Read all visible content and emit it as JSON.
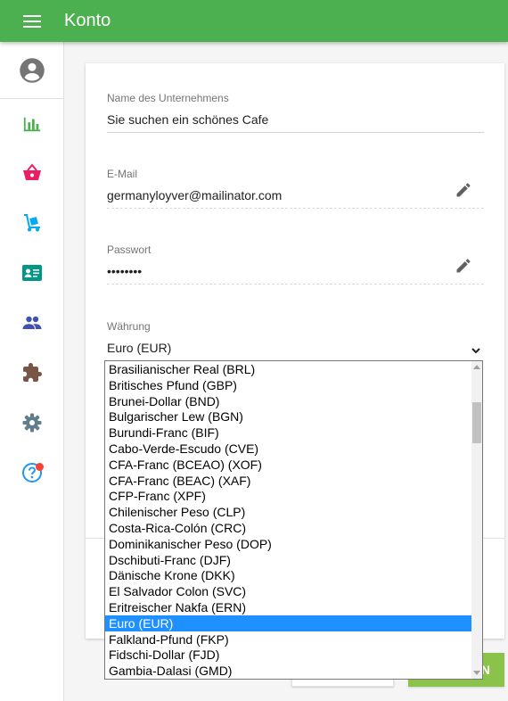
{
  "app": {
    "title": "Konto"
  },
  "sidebar": {
    "items": [
      {
        "name": "avatar",
        "icon": "account-circle-icon",
        "color": "#757575"
      },
      {
        "name": "statistics",
        "icon": "bar-chart-icon",
        "color": "#4caf50"
      },
      {
        "name": "shop",
        "icon": "shopping-basket-icon",
        "color": "#e91e63"
      },
      {
        "name": "delivery",
        "icon": "hand-truck-icon",
        "color": "#03a9f4"
      },
      {
        "name": "contacts",
        "icon": "contact-card-icon",
        "color": "#009688"
      },
      {
        "name": "people",
        "icon": "people-icon",
        "color": "#3f51b5"
      },
      {
        "name": "extensions",
        "icon": "puzzle-icon",
        "color": "#795548"
      },
      {
        "name": "settings",
        "icon": "gear-icon",
        "color": "#607d8b"
      },
      {
        "name": "help",
        "icon": "help-circle-icon",
        "color": "#2196f3",
        "badge_color": "#f44336"
      }
    ]
  },
  "form": {
    "company": {
      "label": "Name des Unternehmens",
      "value": "Sie suchen ein schönes Cafe"
    },
    "email": {
      "label": "E-Mail",
      "value": "germanyloyver@mailinator.com"
    },
    "password": {
      "label": "Passwort",
      "value": "••••••••"
    },
    "currency": {
      "label": "Währung",
      "value": "Euro (EUR)"
    }
  },
  "dropdown": {
    "options": [
      "Brasilianischer Real (BRL)",
      "Britisches Pfund (GBP)",
      "Brunei-Dollar (BND)",
      "Bulgarischer Lew (BGN)",
      "Burundi-Franc (BIF)",
      "Cabo-Verde-Escudo (CVE)",
      "CFA-Franc (BCEAO) (XOF)",
      "CFA-Franc (BEAC) (XAF)",
      "CFP-Franc (XPF)",
      "Chilenischer Peso (CLP)",
      "Costa-Rica-Colón (CRC)",
      "Dominikanischer Peso (DOP)",
      "Dschibuti-Franc (DJF)",
      "Dänische Krone (DKK)",
      "El Salvador Colon (SVC)",
      "Eritreischer Nakfa (ERN)",
      "Euro (EUR)",
      "Falkland-Pfund (FKP)",
      "Fidschi-Dollar (FJD)",
      "Gambia-Dalasi (GMD)"
    ],
    "selected_index": 16
  },
  "buttons": {
    "save_label_visible": "N"
  },
  "colors": {
    "primary": "#4caf50",
    "accent_button": "#8bc34a",
    "selection": "#1e90ff"
  }
}
